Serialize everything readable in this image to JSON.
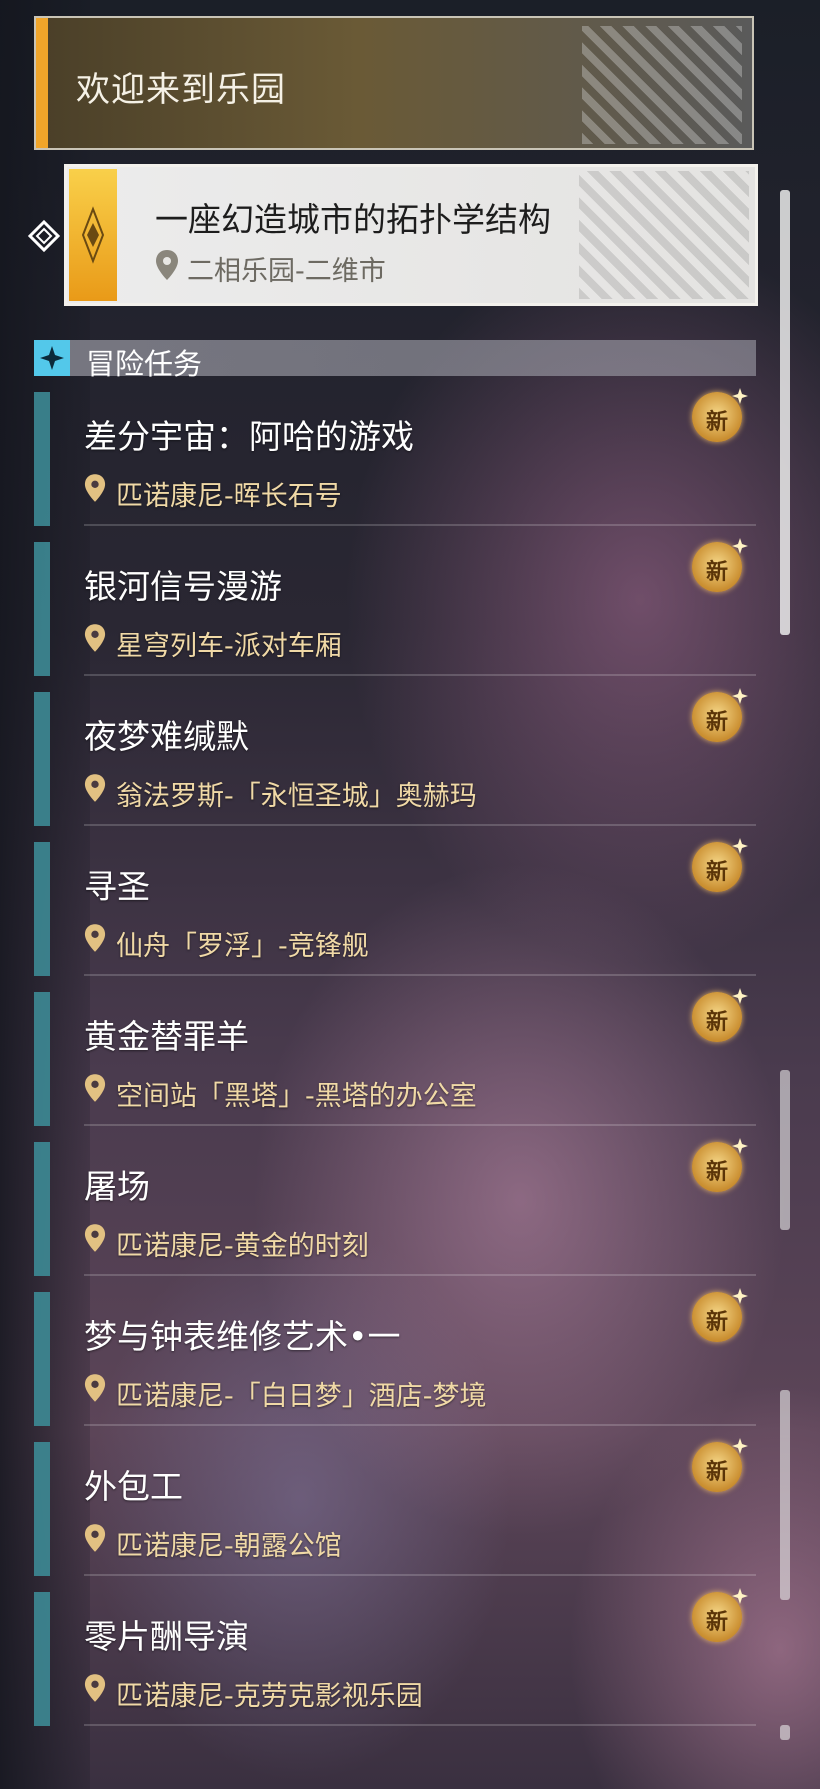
{
  "welcome": {
    "title": "欢迎来到乐园"
  },
  "featured_quest": {
    "title": "一座幻造城市的拓扑学结构",
    "location": "二相乐园-二维市"
  },
  "section": {
    "title": "冒险任务"
  },
  "new_badge_label": "新",
  "missions": [
    {
      "name": "差分宇宙：阿哈的游戏",
      "location": "匹诺康尼-晖长石号"
    },
    {
      "name": "银河信号漫游",
      "location": "星穹列车-派对车厢"
    },
    {
      "name": "夜梦难缄默",
      "location": "翁法罗斯-「永恒圣城」奥赫玛"
    },
    {
      "name": "寻圣",
      "location": "仙舟「罗浮」-竞锋舰"
    },
    {
      "name": "黄金替罪羊",
      "location": "空间站「黑塔」-黑塔的办公室"
    },
    {
      "name": "屠场",
      "location": "匹诺康尼-黄金的时刻"
    },
    {
      "name": "梦与钟表维修艺术•一",
      "location": "匹诺康尼-「白日梦」酒店-梦境"
    },
    {
      "name": "外包工",
      "location": "匹诺康尼-朝露公馆"
    },
    {
      "name": "零片酬导演",
      "location": "匹诺康尼-克劳克影视乐园"
    }
  ],
  "colors": {
    "accent_gold": "#f0a52a",
    "mission_bar": "#3d8a95",
    "section_icon": "#53c8ea",
    "location_text": "#f0d9a6"
  }
}
